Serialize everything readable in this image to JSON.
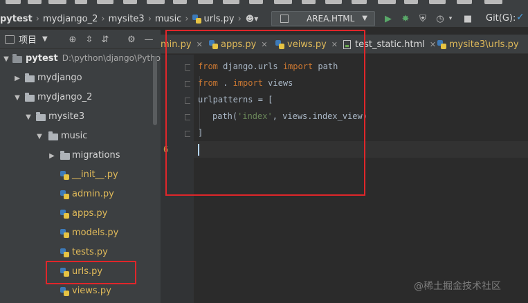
{
  "breadcrumb": {
    "items": [
      "pytest",
      "mydjango_2",
      "mysite3",
      "music",
      "urls.py"
    ]
  },
  "toolbar": {
    "run_configuration": "AREA.HTML",
    "git_label": "Git(G):"
  },
  "project_panel": {
    "title": "项目"
  },
  "tree": {
    "root": {
      "label": "pytest",
      "path": "D:\\python\\django\\Python"
    },
    "items": [
      {
        "label": "mydjango"
      },
      {
        "label": "mydjango_2"
      },
      {
        "label": "mysite3"
      },
      {
        "label": "music"
      },
      {
        "label": "migrations"
      },
      {
        "label": "__init__.py"
      },
      {
        "label": "admin.py"
      },
      {
        "label": "apps.py"
      },
      {
        "label": "models.py"
      },
      {
        "label": "tests.py"
      },
      {
        "label": "urls.py"
      },
      {
        "label": "views.py"
      }
    ]
  },
  "tabs": [
    {
      "label": "min.py"
    },
    {
      "label": "apps.py"
    },
    {
      "label": "veiws.py"
    },
    {
      "label": "test_static.html"
    },
    {
      "label": "mysite3\\urls.py"
    }
  ],
  "editor": {
    "line_number": "6",
    "line1": {
      "kw1": "from",
      "mod": " django.urls ",
      "kw2": "import",
      "name": " path"
    },
    "line2": {
      "kw1": "from",
      "mod": " . ",
      "kw2": "import",
      "name": " views"
    },
    "line3": {
      "text": "urlpatterns = ["
    },
    "line4": {
      "pre": "path(",
      "str": "'index'",
      "post": ", views.index_view)"
    },
    "line5": {
      "text": "]"
    }
  },
  "watermark": "@稀土掘金技术社区",
  "colors": {
    "highlight_box": "#e0262a",
    "keyword": "#cc7832",
    "string": "#6a8759",
    "python_file_label": "#e0ba5a"
  }
}
